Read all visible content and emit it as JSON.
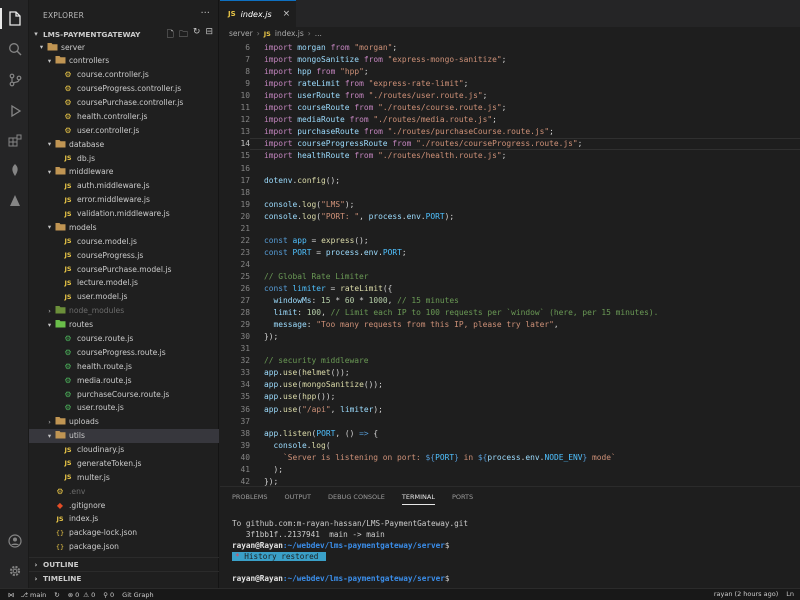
{
  "sidebar": {
    "title": "EXPLORER",
    "project": "LMS-PAYMENTGATEWAY",
    "tree": [
      {
        "label": "server",
        "depth": 1,
        "type": "folder",
        "open": true
      },
      {
        "label": "controllers",
        "depth": 2,
        "type": "folder",
        "open": true
      },
      {
        "label": "course.controller.js",
        "depth": 3,
        "type": "gear"
      },
      {
        "label": "courseProgress.controller.js",
        "depth": 3,
        "type": "gear"
      },
      {
        "label": "coursePurchase.controller.js",
        "depth": 3,
        "type": "gear"
      },
      {
        "label": "health.controller.js",
        "depth": 3,
        "type": "gear"
      },
      {
        "label": "user.controller.js",
        "depth": 3,
        "type": "gear"
      },
      {
        "label": "database",
        "depth": 2,
        "type": "folder",
        "open": true
      },
      {
        "label": "db.js",
        "depth": 3,
        "type": "js"
      },
      {
        "label": "middleware",
        "depth": 2,
        "type": "folder",
        "open": true
      },
      {
        "label": "auth.middleware.js",
        "depth": 3,
        "type": "js"
      },
      {
        "label": "error.middleware.js",
        "depth": 3,
        "type": "js"
      },
      {
        "label": "validation.middleware.js",
        "depth": 3,
        "type": "js"
      },
      {
        "label": "models",
        "depth": 2,
        "type": "folder",
        "open": true
      },
      {
        "label": "course.model.js",
        "depth": 3,
        "type": "js"
      },
      {
        "label": "courseProgress.js",
        "depth": 3,
        "type": "js"
      },
      {
        "label": "coursePurchase.model.js",
        "depth": 3,
        "type": "js"
      },
      {
        "label": "lecture.model.js",
        "depth": 3,
        "type": "js"
      },
      {
        "label": "user.model.js",
        "depth": 3,
        "type": "js"
      },
      {
        "label": "node_modules",
        "depth": 2,
        "type": "folder",
        "open": false,
        "dim": true
      },
      {
        "label": "routes",
        "depth": 2,
        "type": "folder",
        "open": true
      },
      {
        "label": "course.route.js",
        "depth": 3,
        "type": "route"
      },
      {
        "label": "courseProgress.route.js",
        "depth": 3,
        "type": "route"
      },
      {
        "label": "health.route.js",
        "depth": 3,
        "type": "route"
      },
      {
        "label": "media.route.js",
        "depth": 3,
        "type": "route"
      },
      {
        "label": "purchaseCourse.route.js",
        "depth": 3,
        "type": "route"
      },
      {
        "label": "user.route.js",
        "depth": 3,
        "type": "route"
      },
      {
        "label": "uploads",
        "depth": 2,
        "type": "folder",
        "open": false
      },
      {
        "label": "utils",
        "depth": 2,
        "type": "folder",
        "open": true,
        "selected": true
      },
      {
        "label": "cloudinary.js",
        "depth": 3,
        "type": "js"
      },
      {
        "label": "generateToken.js",
        "depth": 3,
        "type": "js"
      },
      {
        "label": "multer.js",
        "depth": 3,
        "type": "js"
      },
      {
        "label": ".env",
        "depth": 2,
        "type": "env",
        "dim": true
      },
      {
        "label": ".gitignore",
        "depth": 2,
        "type": "git"
      },
      {
        "label": "index.js",
        "depth": 2,
        "type": "js"
      },
      {
        "label": "package-lock.json",
        "depth": 2,
        "type": "json"
      },
      {
        "label": "package.json",
        "depth": 2,
        "type": "json"
      }
    ],
    "outline": "OUTLINE",
    "timeline": "TIMELINE"
  },
  "editor": {
    "tab": {
      "icon": "JS",
      "label": "index.js",
      "close": "×"
    },
    "breadcrumb": [
      "server",
      "index.js",
      "..."
    ],
    "current_line": 14
  },
  "code_lines": [
    {
      "n": 6,
      "tokens": [
        [
          "k",
          "import"
        ],
        [
          "",
          " "
        ],
        [
          "v",
          "morgan"
        ],
        [
          "",
          " "
        ],
        [
          "k",
          "from"
        ],
        [
          "",
          " "
        ],
        [
          "s",
          "\"morgan\""
        ],
        [
          "",
          ";"
        ]
      ]
    },
    {
      "n": 7,
      "tokens": [
        [
          "k",
          "import"
        ],
        [
          "",
          " "
        ],
        [
          "v",
          "mongoSanitize"
        ],
        [
          "",
          " "
        ],
        [
          "k",
          "from"
        ],
        [
          "",
          " "
        ],
        [
          "s",
          "\"express-mongo-sanitize\""
        ],
        [
          "",
          ";"
        ]
      ]
    },
    {
      "n": 8,
      "tokens": [
        [
          "k",
          "import"
        ],
        [
          "",
          " "
        ],
        [
          "v",
          "hpp"
        ],
        [
          "",
          " "
        ],
        [
          "k",
          "from"
        ],
        [
          "",
          " "
        ],
        [
          "s",
          "\"hpp\""
        ],
        [
          "",
          ";"
        ]
      ]
    },
    {
      "n": 9,
      "tokens": [
        [
          "k",
          "import"
        ],
        [
          "",
          " "
        ],
        [
          "v",
          "rateLimit"
        ],
        [
          "",
          " "
        ],
        [
          "k",
          "from"
        ],
        [
          "",
          " "
        ],
        [
          "s",
          "\"express-rate-limit\""
        ],
        [
          "",
          ";"
        ]
      ]
    },
    {
      "n": 10,
      "tokens": [
        [
          "k",
          "import"
        ],
        [
          "",
          " "
        ],
        [
          "v",
          "userRoute"
        ],
        [
          "",
          " "
        ],
        [
          "k",
          "from"
        ],
        [
          "",
          " "
        ],
        [
          "s",
          "\"./routes/user.route.js\""
        ],
        [
          "",
          ";"
        ]
      ]
    },
    {
      "n": 11,
      "tokens": [
        [
          "k",
          "import"
        ],
        [
          "",
          " "
        ],
        [
          "v",
          "courseRoute"
        ],
        [
          "",
          " "
        ],
        [
          "k",
          "from"
        ],
        [
          "",
          " "
        ],
        [
          "s",
          "\"./routes/course.route.js\""
        ],
        [
          "",
          ";"
        ]
      ]
    },
    {
      "n": 12,
      "tokens": [
        [
          "k",
          "import"
        ],
        [
          "",
          " "
        ],
        [
          "v",
          "mediaRoute"
        ],
        [
          "",
          " "
        ],
        [
          "k",
          "from"
        ],
        [
          "",
          " "
        ],
        [
          "s",
          "\"./routes/media.route.js\""
        ],
        [
          "",
          ";"
        ]
      ]
    },
    {
      "n": 13,
      "tokens": [
        [
          "k",
          "import"
        ],
        [
          "",
          " "
        ],
        [
          "v",
          "purchaseRoute"
        ],
        [
          "",
          " "
        ],
        [
          "k",
          "from"
        ],
        [
          "",
          " "
        ],
        [
          "s",
          "\"./routes/purchaseCourse.route.js\""
        ],
        [
          "",
          ";"
        ]
      ]
    },
    {
      "n": 14,
      "tokens": [
        [
          "k",
          "import"
        ],
        [
          "",
          " "
        ],
        [
          "v",
          "courseProgressRoute"
        ],
        [
          "",
          " "
        ],
        [
          "k",
          "from"
        ],
        [
          "",
          " "
        ],
        [
          "s",
          "\"./routes/courseProgress.route.js\""
        ],
        [
          "",
          ";"
        ]
      ]
    },
    {
      "n": 15,
      "tokens": [
        [
          "k",
          "import"
        ],
        [
          "",
          " "
        ],
        [
          "v",
          "healthRoute"
        ],
        [
          "",
          " "
        ],
        [
          "k",
          "from"
        ],
        [
          "",
          " "
        ],
        [
          "s",
          "\"./routes/health.route.js\""
        ],
        [
          "",
          ";"
        ]
      ]
    },
    {
      "n": 16,
      "tokens": []
    },
    {
      "n": 17,
      "tokens": [
        [
          "v",
          "dotenv"
        ],
        [
          "",
          "."
        ],
        [
          "c",
          "config"
        ],
        [
          "",
          "();"
        ]
      ]
    },
    {
      "n": 18,
      "tokens": []
    },
    {
      "n": 19,
      "tokens": [
        [
          "v",
          "console"
        ],
        [
          "",
          "."
        ],
        [
          "c",
          "log"
        ],
        [
          "",
          "("
        ],
        [
          "s",
          "\"LMS\""
        ],
        [
          "",
          ");"
        ]
      ]
    },
    {
      "n": 20,
      "tokens": [
        [
          "v",
          "console"
        ],
        [
          "",
          "."
        ],
        [
          "c",
          "log"
        ],
        [
          "",
          "("
        ],
        [
          "s",
          "\"PORT: \""
        ],
        [
          "",
          ", "
        ],
        [
          "v",
          "process"
        ],
        [
          "",
          "."
        ],
        [
          "v",
          "env"
        ],
        [
          "",
          "."
        ],
        [
          "vv",
          "PORT"
        ],
        [
          "",
          ");"
        ]
      ]
    },
    {
      "n": 21,
      "tokens": []
    },
    {
      "n": 22,
      "tokens": [
        [
          "kb",
          "const"
        ],
        [
          "",
          " "
        ],
        [
          "vv",
          "app"
        ],
        [
          "",
          " = "
        ],
        [
          "c",
          "express"
        ],
        [
          "",
          "();"
        ]
      ]
    },
    {
      "n": 23,
      "tokens": [
        [
          "kb",
          "const"
        ],
        [
          "",
          " "
        ],
        [
          "vv",
          "PORT"
        ],
        [
          "",
          " = "
        ],
        [
          "v",
          "process"
        ],
        [
          "",
          "."
        ],
        [
          "v",
          "env"
        ],
        [
          "",
          "."
        ],
        [
          "vv",
          "PORT"
        ],
        [
          "",
          ";"
        ]
      ]
    },
    {
      "n": 24,
      "tokens": []
    },
    {
      "n": 25,
      "tokens": [
        [
          "cm",
          "// Global Rate Limiter"
        ]
      ]
    },
    {
      "n": 26,
      "tokens": [
        [
          "kb",
          "const"
        ],
        [
          "",
          " "
        ],
        [
          "vv",
          "limiter"
        ],
        [
          "",
          " = "
        ],
        [
          "c",
          "rateLimit"
        ],
        [
          "",
          "({"
        ]
      ]
    },
    {
      "n": 27,
      "tokens": [
        [
          "",
          "  "
        ],
        [
          "v",
          "windowMs"
        ],
        [
          "",
          ": "
        ],
        [
          "n",
          "15"
        ],
        [
          "",
          " * "
        ],
        [
          "n",
          "60"
        ],
        [
          "",
          " * "
        ],
        [
          "n",
          "1000"
        ],
        [
          "",
          ", "
        ],
        [
          "cm",
          "// 15 minutes"
        ]
      ]
    },
    {
      "n": 28,
      "tokens": [
        [
          "",
          "  "
        ],
        [
          "v",
          "limit"
        ],
        [
          "",
          ": "
        ],
        [
          "n",
          "100"
        ],
        [
          "",
          ", "
        ],
        [
          "cm",
          "// Limit each IP to 100 requests per `window` (here, per 15 minutes)."
        ]
      ]
    },
    {
      "n": 29,
      "tokens": [
        [
          "",
          "  "
        ],
        [
          "v",
          "message"
        ],
        [
          "",
          ": "
        ],
        [
          "s",
          "\"Too many requests from this IP, please try later\""
        ],
        [
          "",
          ","
        ]
      ]
    },
    {
      "n": 30,
      "tokens": [
        [
          "",
          "});"
        ]
      ]
    },
    {
      "n": 31,
      "tokens": []
    },
    {
      "n": 32,
      "tokens": [
        [
          "cm",
          "// security middleware"
        ]
      ]
    },
    {
      "n": 33,
      "tokens": [
        [
          "v",
          "app"
        ],
        [
          "",
          "."
        ],
        [
          "c",
          "use"
        ],
        [
          "",
          "("
        ],
        [
          "c",
          "helmet"
        ],
        [
          "",
          "());"
        ]
      ]
    },
    {
      "n": 34,
      "tokens": [
        [
          "v",
          "app"
        ],
        [
          "",
          "."
        ],
        [
          "c",
          "use"
        ],
        [
          "",
          "("
        ],
        [
          "c",
          "mongoSanitize"
        ],
        [
          "",
          "());"
        ]
      ]
    },
    {
      "n": 35,
      "tokens": [
        [
          "v",
          "app"
        ],
        [
          "",
          "."
        ],
        [
          "c",
          "use"
        ],
        [
          "",
          "("
        ],
        [
          "c",
          "hpp"
        ],
        [
          "",
          "());"
        ]
      ]
    },
    {
      "n": 36,
      "tokens": [
        [
          "v",
          "app"
        ],
        [
          "",
          "."
        ],
        [
          "c",
          "use"
        ],
        [
          "",
          "("
        ],
        [
          "s",
          "\"/api\""
        ],
        [
          "",
          ", "
        ],
        [
          "v",
          "limiter"
        ],
        [
          "",
          ");"
        ]
      ]
    },
    {
      "n": 37,
      "tokens": []
    },
    {
      "n": 38,
      "tokens": [
        [
          "v",
          "app"
        ],
        [
          "",
          "."
        ],
        [
          "c",
          "listen"
        ],
        [
          "",
          "("
        ],
        [
          "vv",
          "PORT"
        ],
        [
          "",
          ", () "
        ],
        [
          "kb",
          "=>"
        ],
        [
          "",
          " {"
        ]
      ]
    },
    {
      "n": 39,
      "tokens": [
        [
          "",
          "  "
        ],
        [
          "v",
          "console"
        ],
        [
          "",
          "."
        ],
        [
          "c",
          "log"
        ],
        [
          "",
          "("
        ]
      ]
    },
    {
      "n": 40,
      "tokens": [
        [
          "",
          "    "
        ],
        [
          "s",
          "`Server is listening on port: "
        ],
        [
          "kb",
          "${"
        ],
        [
          "vv",
          "PORT"
        ],
        [
          "kb",
          "}"
        ],
        [
          "s",
          " in "
        ],
        [
          "kb",
          "${"
        ],
        [
          "v",
          "process"
        ],
        [
          "",
          "."
        ],
        [
          "v",
          "env"
        ],
        [
          "",
          "."
        ],
        [
          "vv",
          "NODE_ENV"
        ],
        [
          "kb",
          "}"
        ],
        [
          "s",
          " mode`"
        ]
      ]
    },
    {
      "n": 41,
      "tokens": [
        [
          "",
          "  );"
        ]
      ]
    },
    {
      "n": 42,
      "tokens": [
        [
          "",
          "});"
        ]
      ]
    }
  ],
  "panel": {
    "tabs": [
      "PROBLEMS",
      "OUTPUT",
      "DEBUG CONSOLE",
      "TERMINAL",
      "PORTS"
    ],
    "active_tab": "TERMINAL",
    "terminal": {
      "line1": "To github.com:m-rayan-hassan/LMS-PaymentGateway.git",
      "line2": "   3f1bb1f..2137941  main -> main",
      "user": "rayan@Rayan",
      "path": ":~/webdev/lms-paymentgateway/server",
      "dollar": "$",
      "history_star": "*",
      "history": " History restored "
    }
  },
  "statusbar": {
    "branch": "main",
    "sync": "↻",
    "errors": "0",
    "warnings": "0",
    "ports": "0",
    "git_graph": "Git Graph",
    "blame": "rayan (2 hours ago)",
    "position": "Ln"
  },
  "colors": {
    "accent": "#0e70c0",
    "folder": "#dcb67a",
    "js": "#e8c547",
    "route": "#4bb15a"
  }
}
